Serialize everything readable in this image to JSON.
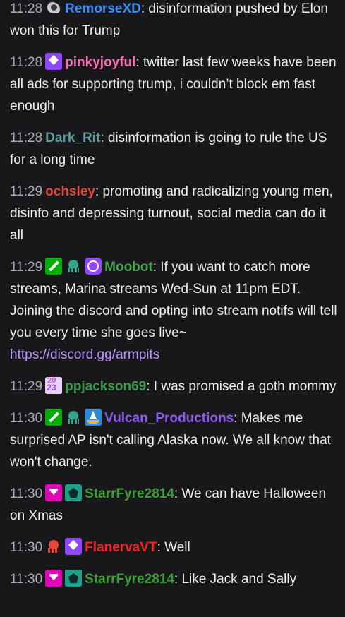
{
  "messages": [
    {
      "time": "11:28",
      "badges": [
        "raven-icon"
      ],
      "user": "RemorseXD",
      "color": "#3a8cff",
      "text": ": disinformation pushed by Elon won this for Trump"
    },
    {
      "time": "11:28",
      "badges": [
        "subscriber-badge-icon"
      ],
      "user": "pinkyjoyful",
      "color": "#ff69b4",
      "text": ": twitter last few weeks have been all ads for supporting trump, i couldn’t block em fast enough"
    },
    {
      "time": "11:28",
      "badges": [],
      "user": "Dark_Rit",
      "color": "#5f9ea0",
      "text": ": disinformation is going to rule the US for a long time"
    },
    {
      "time": "11:29",
      "badges": [],
      "user": "ochsley",
      "color": "#e2483b",
      "text": ": promoting and radicalizing young men, disinfo and depressing turnout, social media can do it all"
    },
    {
      "time": "11:29",
      "badges": [
        "moderator-sword-icon",
        "squid-icon",
        "verified-bot-icon"
      ],
      "user": "Moobot",
      "color": "#41a44a",
      "text": ": If you want to catch more streams, Marina streams Wed-Sun at 11pm EDT. Joining the discord and opting into stream notifs will tell you every time she goes live~ ",
      "link": "https://discord.gg/armpits"
    },
    {
      "time": "11:29",
      "badges": [
        "2023-badge-icon"
      ],
      "user": "ppjackson69",
      "color": "#3b9a4a",
      "text": ": I was promised a goth mommy"
    },
    {
      "time": "11:30",
      "badges": [
        "moderator-sword-icon",
        "squid-icon",
        "sailboat-icon"
      ],
      "user": "Vulcan_Productions",
      "color": "#8a5cf6",
      "text": ": Makes me surprised AP isn't calling Alaska now. We all know that won't change."
    },
    {
      "time": "11:30",
      "badges": [
        "vip-diamond-icon",
        "teal-pentagon-icon"
      ],
      "user": "StarrFyre2814",
      "color": "#3aa035",
      "text": ": We can have Halloween on Xmas"
    },
    {
      "time": "11:30",
      "badges": [
        "red-squid-icon",
        "subscriber-badge-icon"
      ],
      "user": "FlanervaVT",
      "color": "#ff2020",
      "text": ": Well"
    },
    {
      "time": "11:30",
      "badges": [
        "vip-diamond-icon",
        "teal-pentagon-icon"
      ],
      "user": "StarrFyre2814",
      "color": "#3aa035",
      "text": ": Like Jack and Sally"
    }
  ]
}
